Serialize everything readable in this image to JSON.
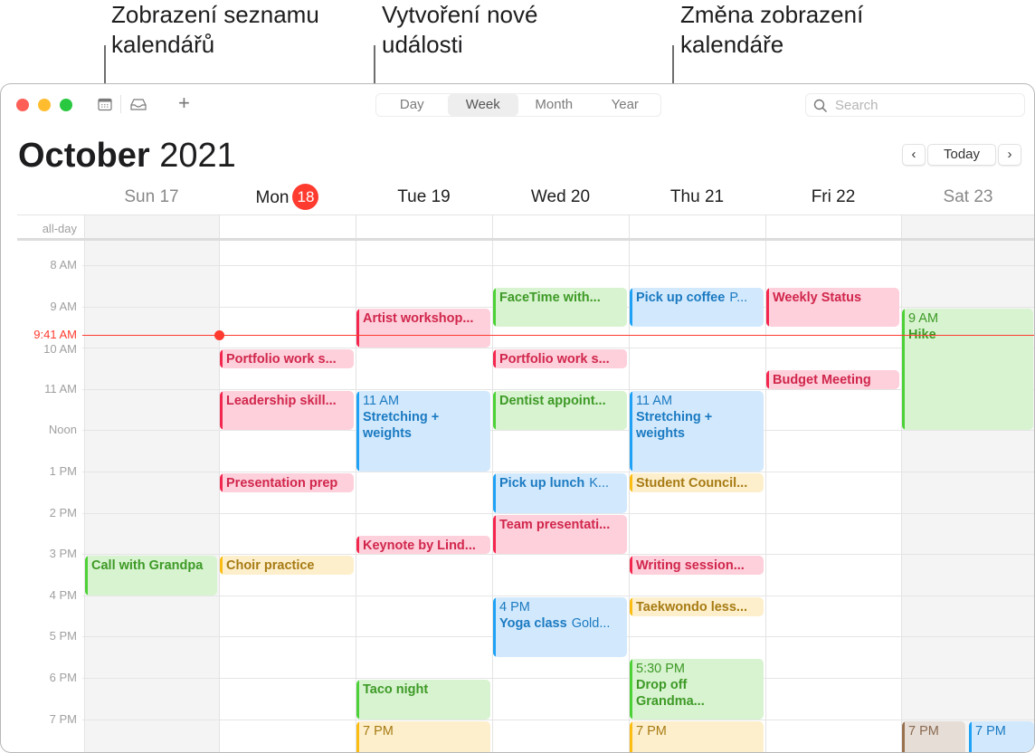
{
  "callouts": {
    "calendar_list": [
      "Zobrazení seznamu",
      "kalendářů"
    ],
    "new_event": [
      "Vytvoření nové",
      "události"
    ],
    "change_view": [
      "Změna zobrazení",
      "kalendáře"
    ]
  },
  "toolbar": {
    "views": [
      "Day",
      "Week",
      "Month",
      "Year"
    ],
    "active_view": "Week",
    "search_placeholder": "Search",
    "add_label": "+"
  },
  "header": {
    "month": "October",
    "year": "2021",
    "today_label": "Today",
    "prev_label": "‹",
    "next_label": "›"
  },
  "days": [
    {
      "label": "Sun 17"
    },
    {
      "label": "Mon",
      "badge": "18"
    },
    {
      "label": "Tue 19"
    },
    {
      "label": "Wed 20"
    },
    {
      "label": "Thu 21"
    },
    {
      "label": "Fri 22"
    },
    {
      "label": "Sat 23"
    }
  ],
  "allday_label": "all-day",
  "hours": [
    "8 AM",
    "9 AM",
    "10 AM",
    "11 AM",
    "Noon",
    "1 PM",
    "2 PM",
    "3 PM",
    "4 PM",
    "5 PM",
    "6 PM",
    "7 PM"
  ],
  "now": {
    "label": "9:41 AM"
  },
  "colors": {
    "accent_red": "#ff3b30",
    "pink": "#f5264e",
    "green": "#4cd137",
    "blue": "#1fa2f5",
    "yellow": "#fbbd12",
    "brown": "#98724f"
  },
  "events": [
    {
      "day": 0,
      "name": "Call with Grandpa",
      "color": "green"
    },
    {
      "day": 1,
      "name": "Portfolio work s...",
      "color": "pink"
    },
    {
      "day": 1,
      "name": "Leadership skill...",
      "color": "pink"
    },
    {
      "day": 1,
      "name": "Presentation prep",
      "color": "pink"
    },
    {
      "day": 1,
      "name": "Choir practice",
      "color": "yellow"
    },
    {
      "day": 2,
      "name": "Artist workshop...",
      "color": "pink"
    },
    {
      "day": 2,
      "time": "11 AM",
      "name": "Stretching + weights",
      "color": "blue"
    },
    {
      "day": 2,
      "name": "Keynote by Lind...",
      "color": "pink"
    },
    {
      "day": 2,
      "name": "Taco night",
      "color": "green"
    },
    {
      "day": 2,
      "time": "7 PM",
      "name": "",
      "color": "yellow"
    },
    {
      "day": 3,
      "name": "FaceTime with...",
      "color": "green"
    },
    {
      "day": 3,
      "name": "Portfolio work s...",
      "color": "pink"
    },
    {
      "day": 3,
      "name": "Dentist appoint...",
      "color": "green"
    },
    {
      "day": 3,
      "name": "Pick up lunch",
      "location": "K...",
      "color": "blue"
    },
    {
      "day": 3,
      "name": "Team presentati...",
      "color": "pink"
    },
    {
      "day": 3,
      "time": "4 PM",
      "name": "Yoga class",
      "location": "Gold...",
      "color": "blue"
    },
    {
      "day": 4,
      "name": "Pick up coffee",
      "location": "P...",
      "color": "blue"
    },
    {
      "day": 4,
      "time": "11 AM",
      "name": "Stretching + weights",
      "color": "blue"
    },
    {
      "day": 4,
      "name": "Student Council...",
      "color": "yellow"
    },
    {
      "day": 4,
      "name": "Writing session...",
      "color": "pink"
    },
    {
      "day": 4,
      "name": "Taekwondo less...",
      "color": "yellow"
    },
    {
      "day": 4,
      "time": "5:30 PM",
      "name": "Drop off Grandma...",
      "color": "green"
    },
    {
      "day": 4,
      "time": "7 PM",
      "name": "",
      "color": "yellow"
    },
    {
      "day": 5,
      "name": "Weekly Status",
      "color": "pink"
    },
    {
      "day": 5,
      "name": "Budget Meeting",
      "color": "pink"
    },
    {
      "day": 6,
      "time": "9 AM",
      "name": "Hike",
      "color": "green"
    },
    {
      "day": 6,
      "time": "7 PM",
      "name": "",
      "color": "brown"
    },
    {
      "day": 6,
      "time": "7 PM",
      "name": "",
      "color": "blue"
    }
  ]
}
